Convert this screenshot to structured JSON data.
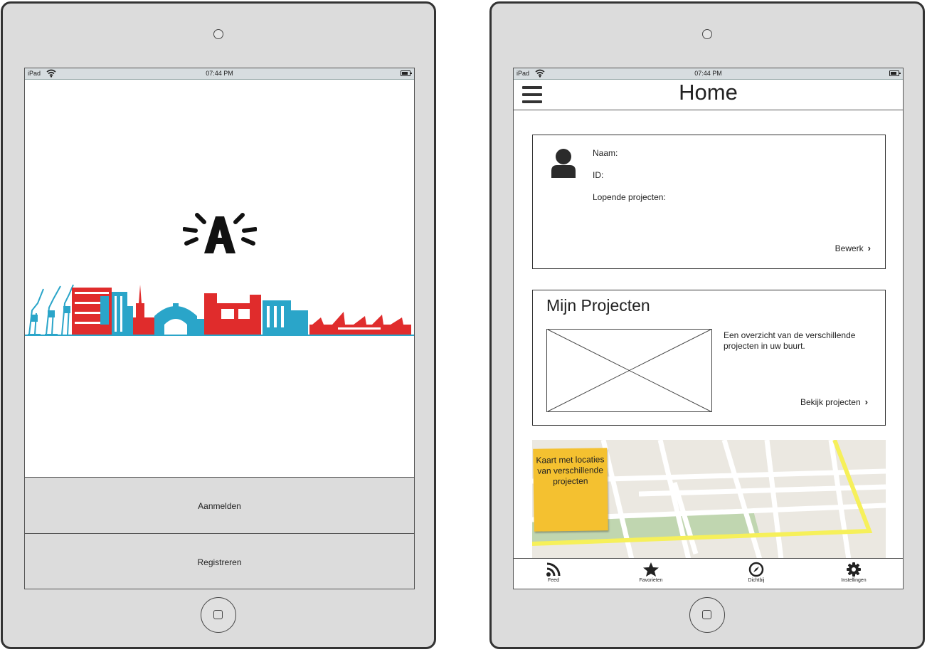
{
  "status_bar": {
    "device": "iPad",
    "time": "07:44 PM"
  },
  "login_screen": {
    "login_button": "Aanmelden",
    "register_button": "Registreren"
  },
  "home_screen": {
    "title": "Home",
    "profile": {
      "name_label": "Naam:",
      "id_label": "ID:",
      "projects_label": "Lopende projecten:",
      "edit_link": "Bewerk"
    },
    "projects": {
      "title": "Mijn Projecten",
      "description": "Een overzicht van de verschillende projecten in uw buurt.",
      "link": "Bekijk projecten"
    },
    "map_note": "Kaart met locaties van verschillende projecten",
    "tabs": [
      {
        "label": "Feed",
        "icon": "rss-icon"
      },
      {
        "label": "Favorieten",
        "icon": "star-icon"
      },
      {
        "label": "Dichtbij",
        "icon": "compass-icon"
      },
      {
        "label": "Instellingen",
        "icon": "gear-icon"
      }
    ]
  },
  "colors": {
    "red": "#e02c2c",
    "blue": "#2aa5c9",
    "sticky_note": "#f4c130"
  }
}
